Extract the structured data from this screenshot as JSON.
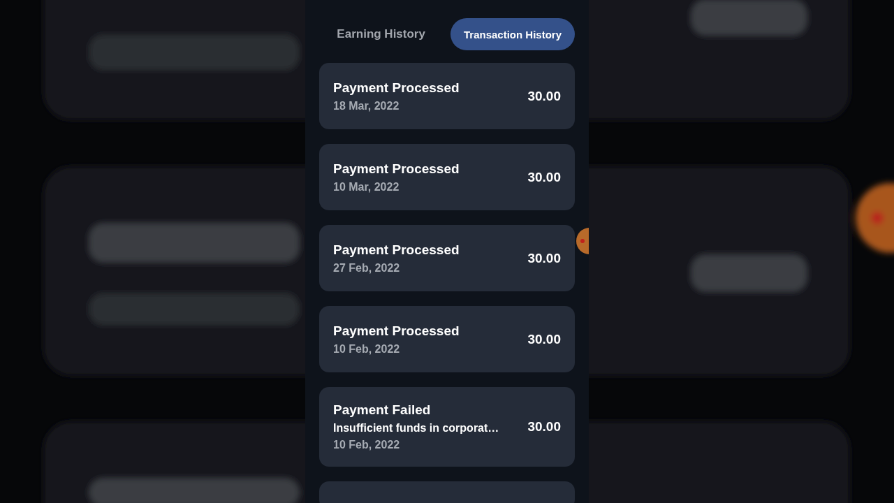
{
  "tabs": [
    {
      "label": "Earning History",
      "selected": false
    },
    {
      "label": "Transaction History",
      "selected": true
    }
  ],
  "transactions": [
    {
      "title": "Payment Processed",
      "date": "18 Mar, 2022",
      "amount": "30.00"
    },
    {
      "title": "Payment Processed",
      "date": "10 Mar, 2022",
      "amount": "30.00"
    },
    {
      "title": "Payment Processed",
      "date": "27 Feb, 2022",
      "amount": "30.00"
    },
    {
      "title": "Payment Processed",
      "date": "10 Feb, 2022",
      "amount": "30.00"
    },
    {
      "title": "Payment Failed",
      "detail": "Insufficient funds in corporat…",
      "date": "10 Feb, 2022",
      "amount": "30.00"
    }
  ]
}
